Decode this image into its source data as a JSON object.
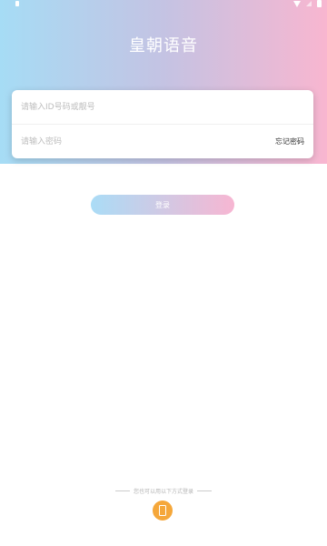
{
  "app": {
    "title": "皇朝语音"
  },
  "login_form": {
    "id_placeholder": "请输入ID号码或靓号",
    "password_placeholder": "请输入密码",
    "forgot_password": "忘记密码",
    "login_button": "登录"
  },
  "alt_login": {
    "text": "您也可以用以下方式登录"
  },
  "icons": {
    "status_left": "notification-icon",
    "wifi": "wifi-icon",
    "signal": "signal-icon",
    "battery": "battery-icon",
    "phone": "phone-icon"
  },
  "colors": {
    "header_gradient_start": "#a6dcf5",
    "header_gradient_end": "#f8b6d0",
    "phone_button": "#f5a73a"
  }
}
